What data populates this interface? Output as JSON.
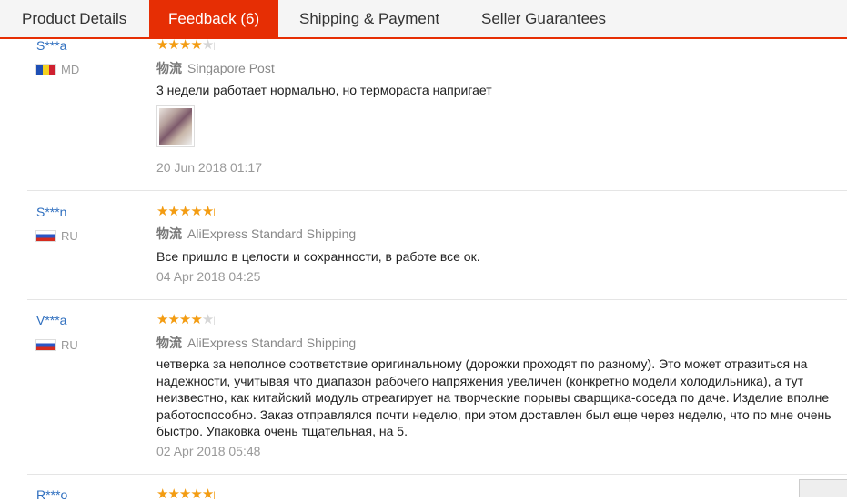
{
  "tabs": [
    {
      "label": "Product Details"
    },
    {
      "label": "Feedback (6)"
    },
    {
      "label": "Shipping & Payment"
    },
    {
      "label": "Seller Guarantees"
    }
  ],
  "logistics_label": "物流",
  "colors": {
    "accent": "#e62e04",
    "star": "#f39c12",
    "username": "#2f6fbf"
  },
  "reviews": [
    {
      "user": "S***a",
      "country": "MD",
      "flag_icon": "moldova-flag-icon",
      "rating_stars": 4,
      "shipping": "Singapore Post",
      "text": [
        "3 недели работает нормально, но термораста напригает"
      ],
      "has_photo": true,
      "date": "20 Jun 2018 01:17"
    },
    {
      "user": "S***n",
      "country": "RU",
      "flag_icon": "russia-flag-icon",
      "rating_stars": 5,
      "shipping": "AliExpress Standard Shipping",
      "text": [
        "Все пришло в целости и сохранности, в работе все ок."
      ],
      "has_photo": false,
      "date": "04 Apr 2018 04:25"
    },
    {
      "user": "V***a",
      "country": "RU",
      "flag_icon": "russia-flag-icon",
      "rating_stars": 4,
      "shipping": "AliExpress Standard Shipping",
      "text": [
        "четверка за неполное соответствие оригинальному (дорожки проходят по разному). Это может отразиться на",
        "надежности, учитывая что диапазон рабочего напряжения увеличен (конкретно модели холодильника), а тут",
        "неизвестно, как китайский модуль отреагирует на творческие порывы сварщика-соседа по даче. Изделие вполне",
        "работоспособно. Заказ отправлялся почти неделю, при этом доставлен был еще через неделю, что по мне очень",
        "быстро. Упаковка очень тщательная, на 5."
      ],
      "has_photo": false,
      "date": "02 Apr 2018 05:48"
    },
    {
      "user": "R***o",
      "rating_stars": 5
    }
  ]
}
